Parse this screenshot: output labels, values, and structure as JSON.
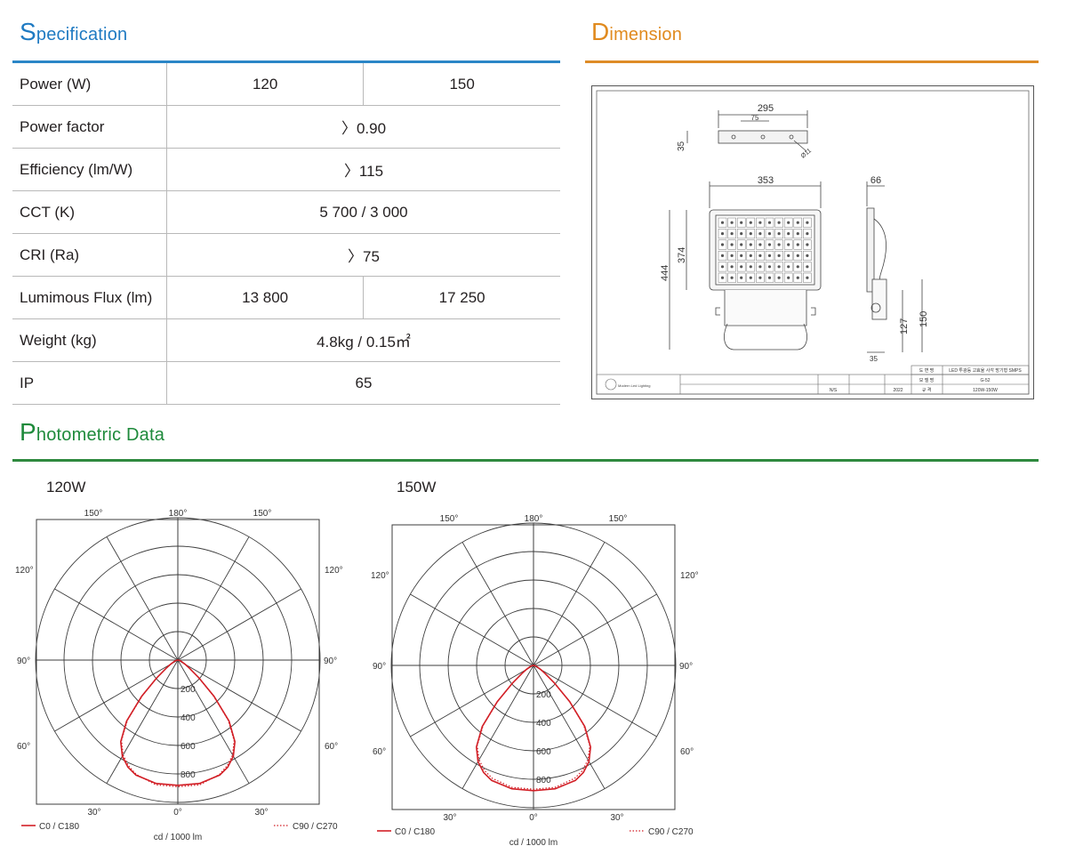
{
  "headings": {
    "specification": {
      "cap": "S",
      "rest": "pecification"
    },
    "dimension": {
      "cap": "D",
      "rest": "imension"
    },
    "photometric": {
      "cap": "P",
      "rest": "hotometric Data"
    }
  },
  "colors": {
    "specification": "#1f7ac2",
    "dimension": "#e08a1e",
    "photometric": "#1e8a3b",
    "curve_c0": "#d21f26"
  },
  "spec_rows": [
    {
      "label": "Power (W)",
      "values": [
        "120",
        "150"
      ]
    },
    {
      "label": "Power factor",
      "values": [
        "〉0.90"
      ]
    },
    {
      "label": "Efficiency (lm/W)",
      "values": [
        "〉115"
      ]
    },
    {
      "label": "CCT (K)",
      "values": [
        "5 700 / 3 000"
      ]
    },
    {
      "label": "CRI (Ra)",
      "values": [
        "〉75"
      ]
    },
    {
      "label": "Lumimous Flux (lm)",
      "values": [
        "13 800",
        "17 250"
      ]
    },
    {
      "label": "Weight (kg)",
      "values": [
        "4.8kg / 0.15㎡"
      ]
    },
    {
      "label": "IP",
      "values": [
        "65"
      ]
    }
  ],
  "dimension": {
    "bracket_width": "295",
    "bracket_hole_spacing": "75",
    "bracket_height": "35",
    "bracket_hole": "Ø11",
    "body_width": "353",
    "body_depth": "66",
    "total_height": "444",
    "body_height": "374",
    "side_height_1": "127",
    "side_height_2": "150",
    "side_bottom": "35",
    "title_block": {
      "product_name_label": "도 면 명",
      "product_name": "LED 투광등 고효율 사각 방기형 SMPS",
      "model_label": "모 델 명",
      "model": "G-52",
      "spec_label": "규 격",
      "spec": "120W-150W",
      "scale": "N/S",
      "year": "2022",
      "company": "Modern Led Lighting"
    }
  },
  "polar_common": {
    "angle_labels": {
      "top": "180°",
      "top_left": "150°",
      "top_right": "150°",
      "upper_left": "120°",
      "upper_right": "120°",
      "left": "90°",
      "right": "90°",
      "lower_left": "60°",
      "lower_right": "60°",
      "bottom_left": "30°",
      "bottom": "0°",
      "bottom_right": "30°"
    },
    "ring_labels": [
      "200",
      "400",
      "600",
      "800"
    ],
    "unit": "cd / 1000 lm",
    "legend_c0": "C0 / C180",
    "legend_c90": "C90 / C270"
  },
  "chart_data": [
    {
      "type": "polar-line",
      "title": "120W",
      "unit": "cd / 1000 lm",
      "rlim": [
        0,
        1000
      ],
      "ring_ticks": [
        200,
        400,
        600,
        800
      ],
      "angle_ticks_deg": [
        0,
        30,
        60,
        90,
        120,
        150,
        180
      ],
      "series": [
        {
          "name": "C0 / C180",
          "style": "solid",
          "angles_deg": [
            0,
            10,
            20,
            25,
            30,
            35,
            40,
            45,
            50,
            55,
            60,
            70,
            80,
            90
          ],
          "values": [
            880,
            880,
            860,
            830,
            780,
            700,
            560,
            360,
            190,
            100,
            60,
            25,
            10,
            0
          ]
        },
        {
          "name": "C90 / C270",
          "style": "dotted",
          "angles_deg": [
            0,
            10,
            20,
            25,
            30,
            35,
            40,
            45,
            50,
            55,
            60,
            70,
            80,
            90
          ],
          "values": [
            890,
            890,
            855,
            820,
            770,
            690,
            550,
            350,
            185,
            95,
            55,
            22,
            8,
            0
          ]
        }
      ]
    },
    {
      "type": "polar-line",
      "title": "150W",
      "unit": "cd / 1000 lm",
      "rlim": [
        0,
        1000
      ],
      "ring_ticks": [
        200,
        400,
        600,
        800
      ],
      "angle_ticks_deg": [
        0,
        30,
        60,
        90,
        120,
        150,
        180
      ],
      "series": [
        {
          "name": "C0 / C180",
          "style": "solid",
          "angles_deg": [
            0,
            10,
            20,
            25,
            30,
            35,
            40,
            45,
            50,
            55,
            60,
            70,
            80,
            90
          ],
          "values": [
            880,
            880,
            860,
            830,
            780,
            700,
            560,
            360,
            190,
            100,
            60,
            25,
            10,
            0
          ]
        },
        {
          "name": "C90 / C270",
          "style": "dotted",
          "angles_deg": [
            0,
            10,
            20,
            25,
            30,
            35,
            40,
            45,
            50,
            55,
            60,
            70,
            80,
            90
          ],
          "values": [
            870,
            870,
            845,
            815,
            765,
            690,
            550,
            355,
            185,
            95,
            55,
            22,
            8,
            0
          ]
        }
      ]
    }
  ]
}
